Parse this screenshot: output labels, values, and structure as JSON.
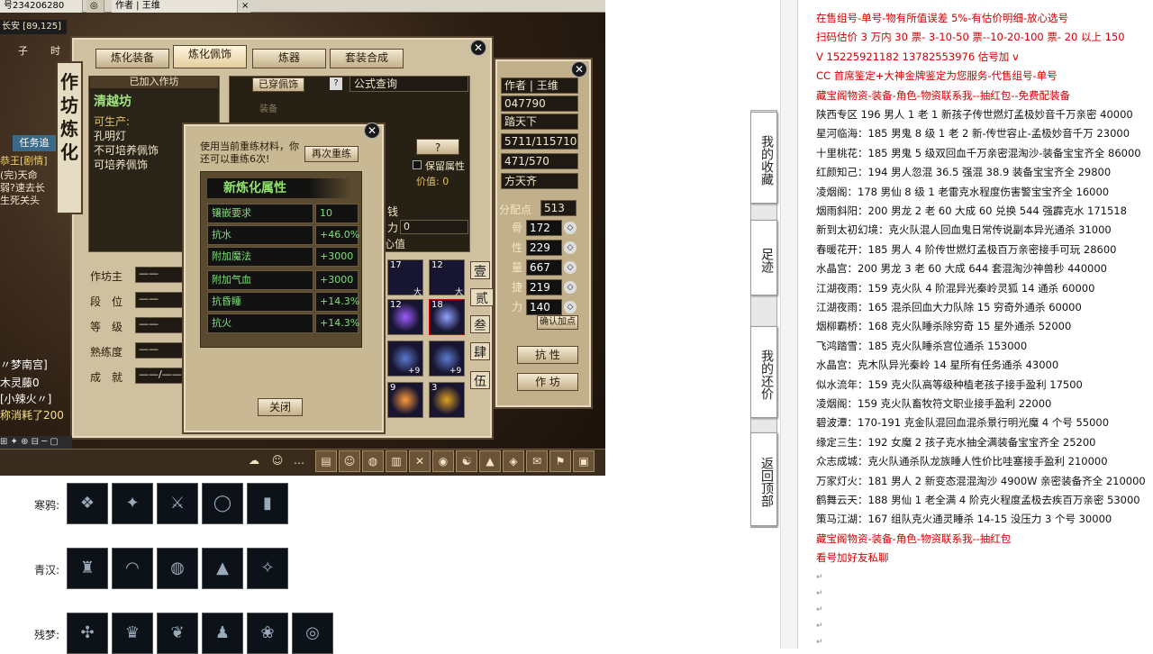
{
  "window": {
    "tabs": [
      "号234206280",
      "作者 | 王维"
    ],
    "coords": "长安 [89,125]",
    "char_name": "作者 | 王维"
  },
  "left_hud": {
    "label_zi": "子",
    "label_day": "时",
    "chat_lines": [
      "任务追",
      "恭王[剧情]",
      "(完)天命",
      "弱?速去长",
      "生死关头",
      "〃梦南宫]",
      "木灵藤0",
      "[小辣火〃]",
      "称消耗了200"
    ]
  },
  "workshop": {
    "vertical_title": "作坊炼化",
    "tabs": [
      "炼化装备",
      "炼化佩饰",
      "炼器",
      "套装合成"
    ],
    "joined_label": "已加入作坊",
    "shop_name": "清越坊",
    "producible_label": "可生产:",
    "producible_items": [
      "孔明灯",
      "不可培养佩饰",
      "可培养佩饰"
    ],
    "fields": [
      {
        "label": "作坊主",
        "value": "——"
      },
      {
        "label": "段　位",
        "value": "——"
      },
      {
        "label": "等　级",
        "value": "——"
      },
      {
        "label": "熟练度",
        "value": "——"
      },
      {
        "label": "成　就",
        "value": "——/——"
      }
    ],
    "worn_label": "已穿佩饰",
    "formula_query": "公式查询",
    "equip_label": "装备",
    "question_label": "?",
    "keep_attr_label": "保留属性",
    "value_label": "价值: 0",
    "money_label": "钱",
    "power_label": "力",
    "power_value": "0",
    "heart_label": "心值"
  },
  "refine_dialog": {
    "notice": "使用当前重练材料，你还可以重练6次!",
    "retry_button": "再次重练",
    "section_title": "新炼化属性",
    "stats": [
      {
        "name": "镶嵌要求",
        "value": "10"
      },
      {
        "name": "抗水",
        "value": "+46.0%"
      },
      {
        "name": "附加魔法",
        "value": "+3000"
      },
      {
        "name": "附加气血",
        "value": "+3000"
      },
      {
        "name": "抗昏睡",
        "value": "+14.3%"
      },
      {
        "name": "抗火",
        "value": "+14.3%"
      }
    ],
    "close_button": "关闭"
  },
  "inventory": {
    "slot_counts": [
      "17",
      "12",
      "12",
      "18",
      "9",
      "3"
    ],
    "slot_badges": [
      "大",
      "大",
      "+9",
      "+9"
    ],
    "side_glyphs": [
      "壹",
      "贰",
      "叁",
      "肆",
      "伍"
    ]
  },
  "character": {
    "id_label": "作者",
    "id_value": "王维",
    "number": "047790",
    "title": "踏天下",
    "hp": "5711/115710",
    "mp": "471/570",
    "faction": "方天齐",
    "points_label": "分配点",
    "points_value": "513",
    "attrs": [
      {
        "name": "骨",
        "value": "172"
      },
      {
        "name": "性",
        "value": "229"
      },
      {
        "name": "量",
        "value": "667"
      },
      {
        "name": "捷",
        "value": "219"
      },
      {
        "name": "力",
        "value": "140"
      }
    ],
    "confirm_button": "确认加点",
    "resist_button": "抗 性",
    "workshop_button": "作 坊"
  },
  "items_page": {
    "rows": [
      {
        "label": "寒鸦:",
        "count": 5
      },
      {
        "label": "青汉:",
        "count": 5
      },
      {
        "label": "残梦:",
        "count": 6
      }
    ]
  },
  "sidebar": {
    "buttons": [
      "我的收藏",
      "足迹",
      "我的还价",
      "返回顶部"
    ]
  },
  "doc": {
    "lines": [
      {
        "text": "在售组号-单号-物有所值误差 5%-有估价明细-放心选号",
        "color": "red"
      },
      {
        "text": "扫码估价 3 万内 30 票- 3-10-50 票--10-20-100 票- 20 以上 150",
        "color": "red"
      },
      {
        "text": "V 15225921182   13782553976   估号加 v",
        "color": "red"
      },
      {
        "text": "CC 首席鉴定+大神金牌鉴定为您服务-代售组号-单号",
        "color": "red"
      },
      {
        "text": "藏宝阁物资-装备-角色-物资联系我--抽红包--免费配装备",
        "color": "red"
      },
      {
        "text": "陕西专区 196 男人 1 老 1 新孩子传世燃灯孟极妙音千万亲密 40000",
        "color": "black"
      },
      {
        "text": "星河临海：185 男鬼 8 级 1 老 2 新-传世容止-孟极妙音千万 23000",
        "color": "black"
      },
      {
        "text": "十里桃花：185 男鬼 5 级双回血千万亲密混淘沙-装备宝宝齐全 86000",
        "color": "black"
      },
      {
        "text": "红颜知己：194 男人忽混 36.5 强混 38.9 装备宝宝齐全 29800",
        "color": "black"
      },
      {
        "text": "凌烟阁：178 男仙 8 级 1 老雷克水程度伤害警宝宝齐全 16000",
        "color": "black"
      },
      {
        "text": "烟雨斜阳：200 男龙 2 老 60 大成 60 兑换 544 强霹克水 171518",
        "color": "black"
      },
      {
        "text": "新到太初幻境：克火队混人回血鬼日常传说副本异光通杀 31000",
        "color": "black"
      },
      {
        "text": "春暖花开：185 男人 4 阶传世燃灯孟极百万亲密接手可玩 28600",
        "color": "black"
      },
      {
        "text": "水晶宫：200 男龙 3 老 60 大成 644 套混淘沙神兽秒 440000",
        "color": "black"
      },
      {
        "text": "江湖夜雨：159 克火队 4 阶混异光秦岭灵狐 14 通杀 60000",
        "color": "black"
      },
      {
        "text": "江湖夜雨：165 混杀回血大力队除 15 穷奇外通杀 60000",
        "color": "black"
      },
      {
        "text": "烟柳霸桥：168 克火队睡杀除穷奇 15 星外通杀 52000",
        "color": "black"
      },
      {
        "text": "飞鸿踏雪：185 克火队睡杀宫位通杀 153000",
        "color": "black"
      },
      {
        "text": "水晶宫：克木队异光秦岭 14 星所有任务通杀 43000",
        "color": "black"
      },
      {
        "text": "似水流年：159 克火队高等级种植老孩子接手盈利 17500",
        "color": "black"
      },
      {
        "text": "凌烟阁：159 克火队畜牧符文职业接手盈利 22000",
        "color": "black"
      },
      {
        "text": "碧波潭：170-191 克金队混回血混杀景行明光魔 4 个号 55000",
        "color": "black"
      },
      {
        "text": "缘定三生：192 女魔 2 孩子克水抽全满装备宝宝齐全 25200",
        "color": "black"
      },
      {
        "text": "众志成城：克火队通杀队龙族睡人性价比哇塞接手盈利 210000",
        "color": "black"
      },
      {
        "text": "万家灯火：181 男人 2 新变态混混淘沙 4900W 亲密装备齐全 210000",
        "color": "black"
      },
      {
        "text": "鹤舞云天：188 男仙 1 老全满 4 阶克火程度孟极去疾百万亲密 53000",
        "color": "black"
      },
      {
        "text": "策马江湖：167 组队克火通灵睡杀 14-15 没压力 3 个号 30000",
        "color": "black"
      },
      {
        "text": "藏宝阁物资-装备-角色-物资联系我--抽红包",
        "color": "red"
      },
      {
        "text": "看号加好友私聊",
        "color": "red"
      }
    ],
    "para_marks": [
      "↵",
      "↵",
      "↵",
      "↵",
      "↵"
    ]
  }
}
